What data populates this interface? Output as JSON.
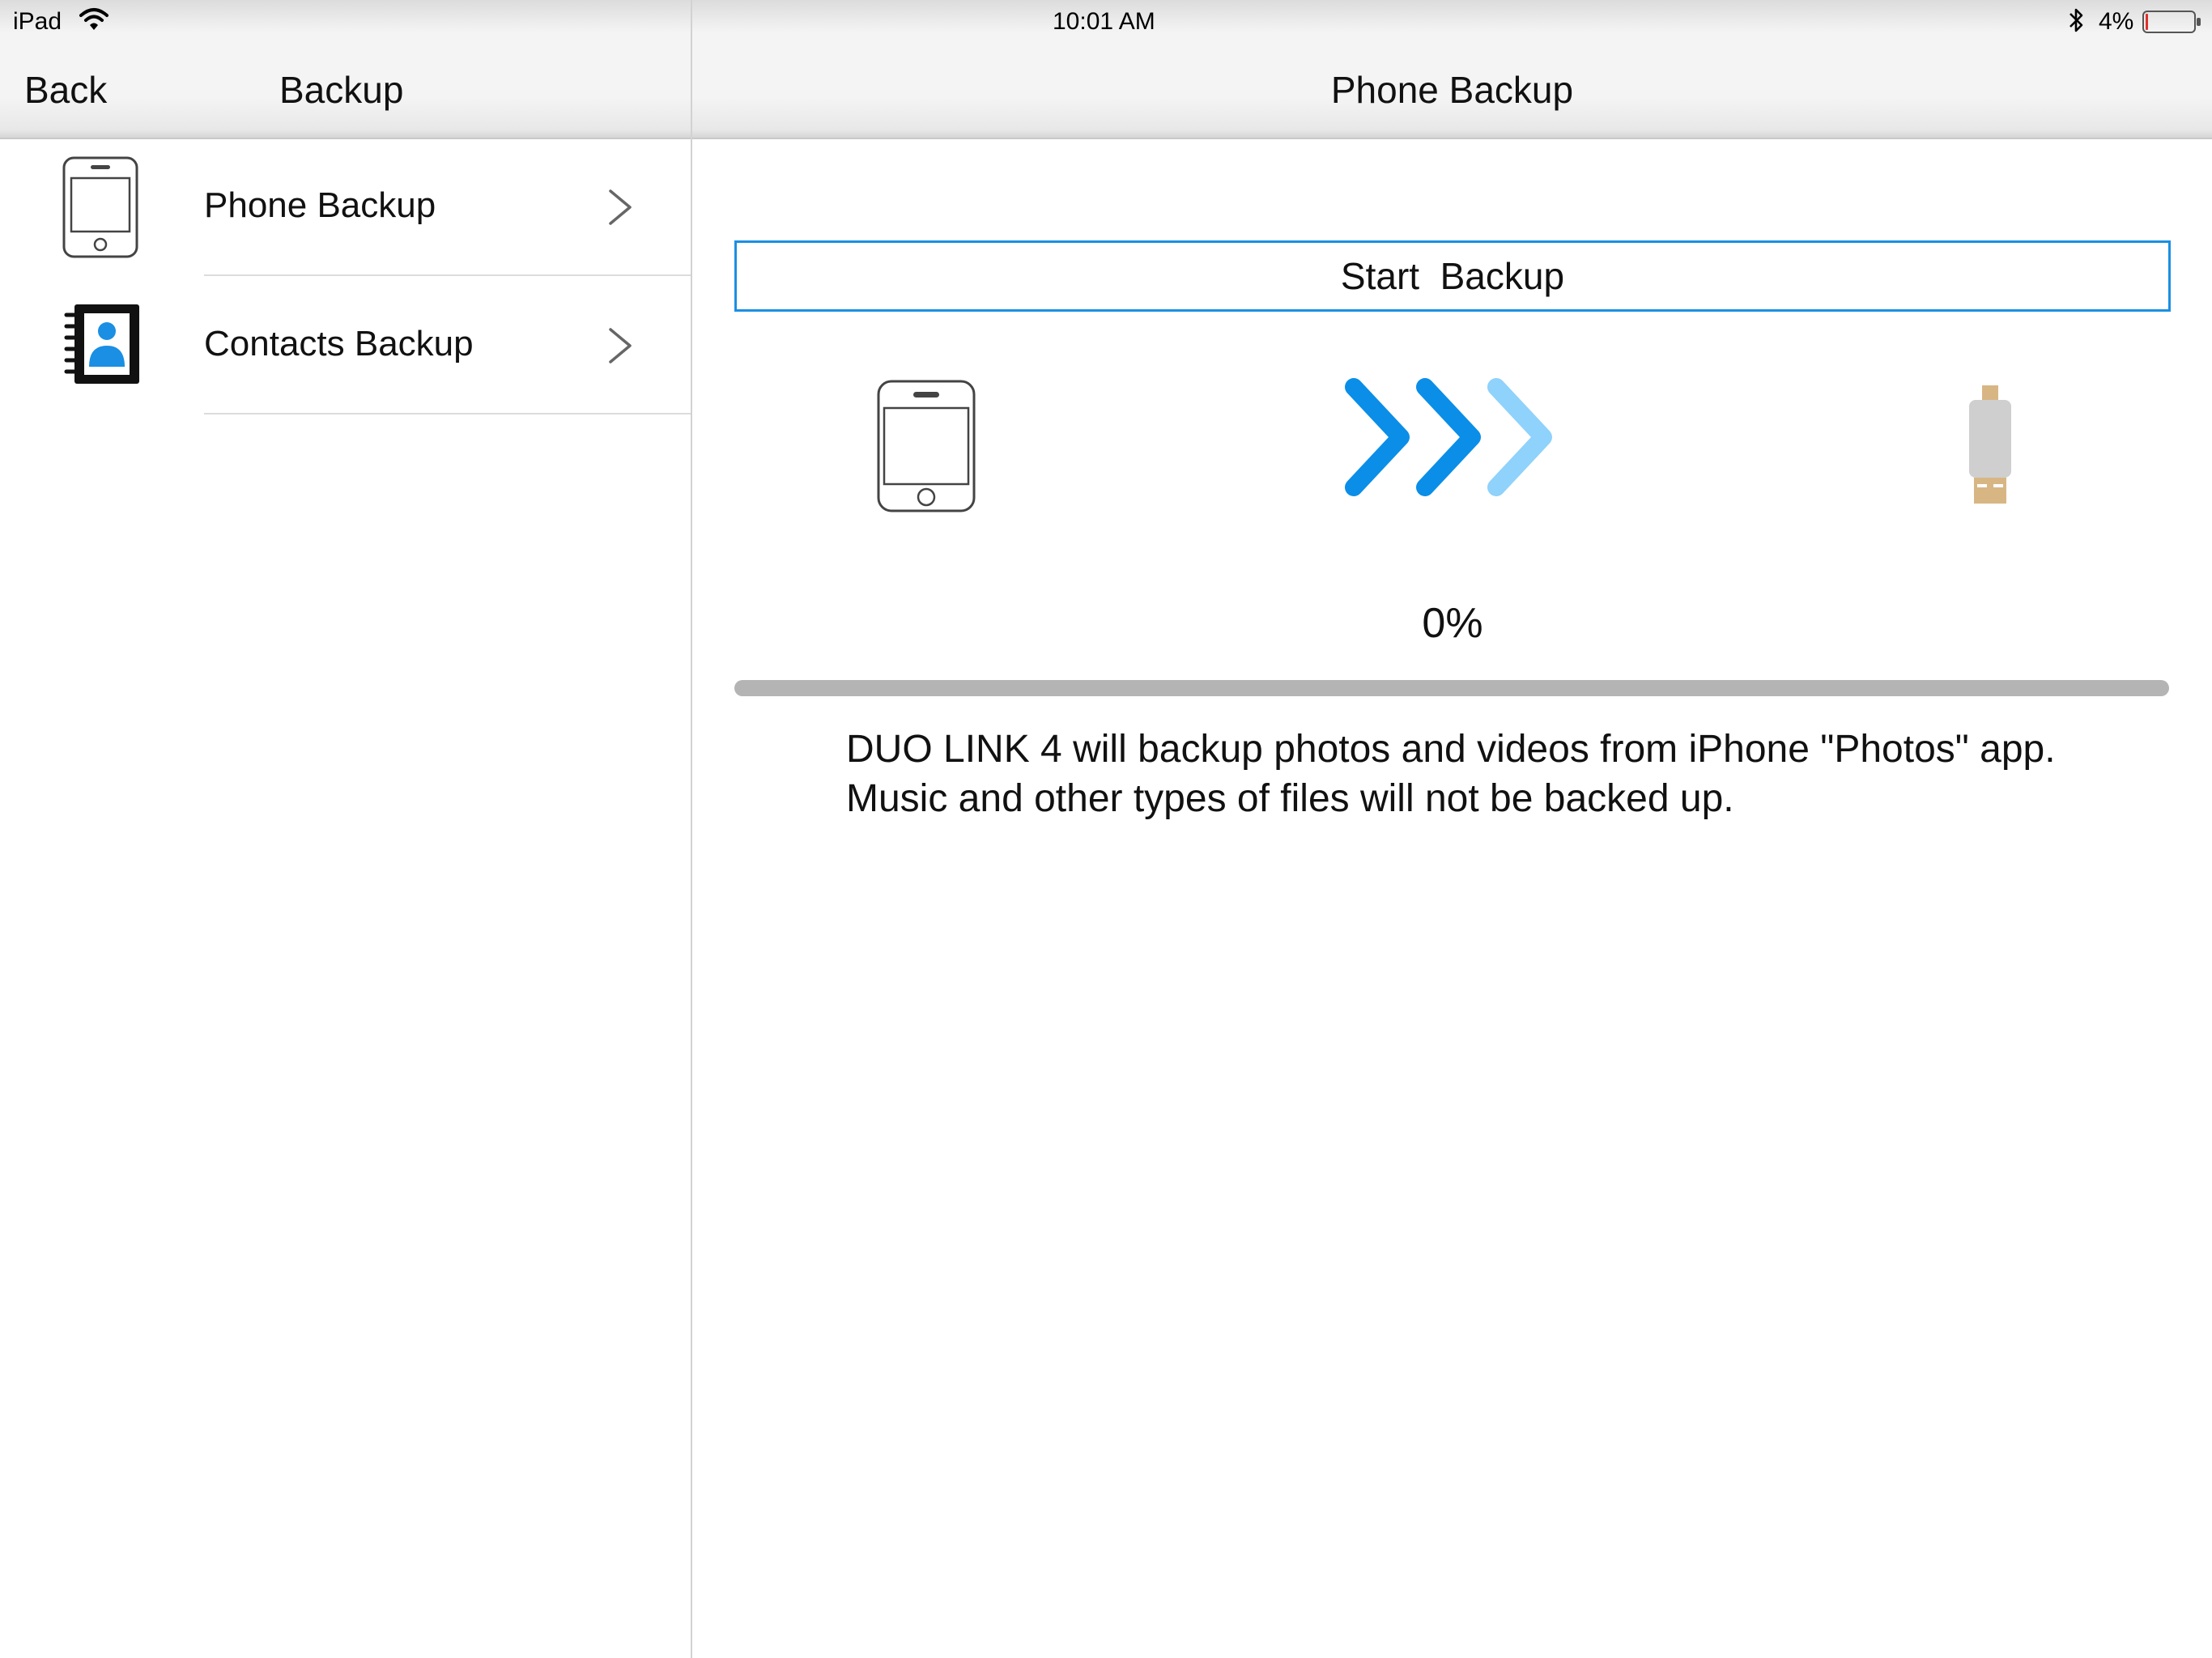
{
  "status_bar": {
    "device": "iPad",
    "time": "10:01 AM",
    "battery_percent": "4%",
    "battery_level": 0.04
  },
  "left_nav": {
    "back_label": "Back",
    "title": "Backup"
  },
  "right_nav": {
    "title": "Phone Backup"
  },
  "list": {
    "items": [
      {
        "label": "Phone Backup",
        "icon": "phone-icon"
      },
      {
        "label": "Contacts Backup",
        "icon": "contacts-book-icon"
      }
    ]
  },
  "backup": {
    "start_label": "Start  Backup",
    "progress_text": "0%",
    "progress_value": 0,
    "note": "DUO LINK 4 will backup photos and videos from iPhone \"Photos\" app. Music and other types of files will not be backed up."
  },
  "colors": {
    "accent": "#1a8fe3",
    "arrow_dark": "#0a8ee8",
    "arrow_light": "#8fd2fb",
    "drive_body": "#cfcfcf",
    "drive_connector": "#d8b684"
  }
}
